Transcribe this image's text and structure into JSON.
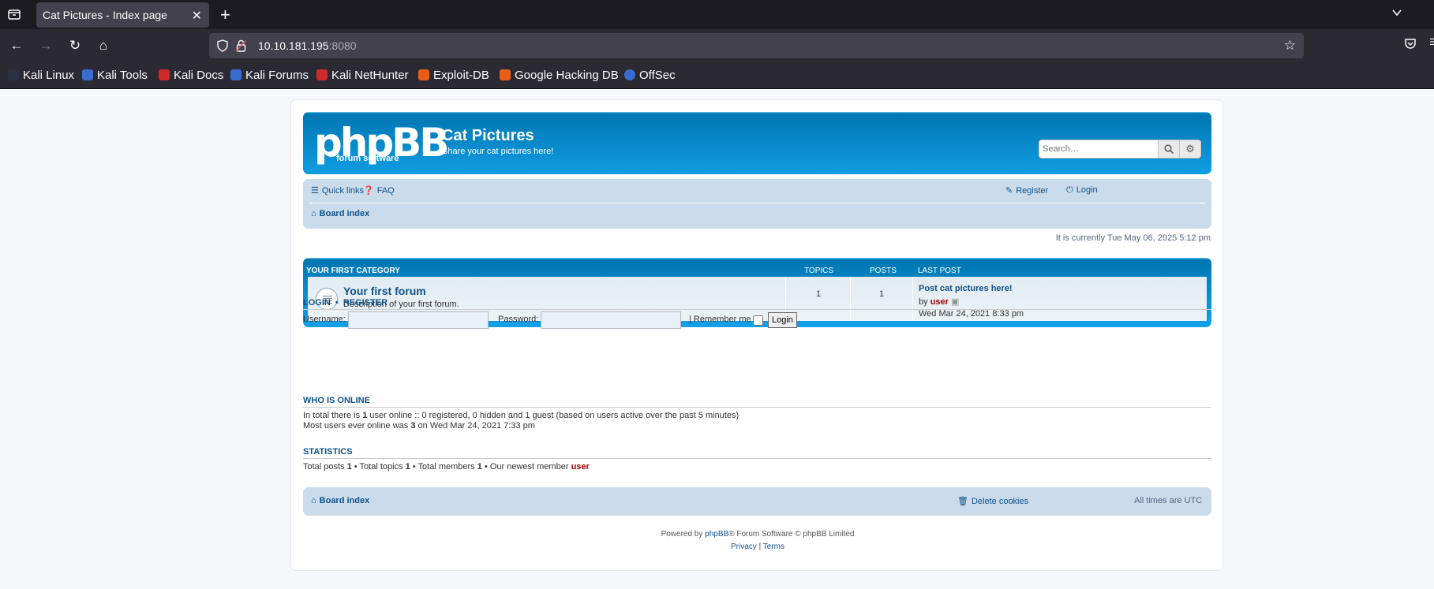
{
  "browser": {
    "tab_title": "Cat Pictures - Index page",
    "url_host": "10.10.181.195",
    "url_port": ":8080",
    "bookmarks": [
      "Kali Linux",
      "Kali Tools",
      "Kali Docs",
      "Kali Forums",
      "Kali NetHunter",
      "Exploit-DB",
      "Google Hacking DB",
      "OffSec"
    ]
  },
  "header": {
    "logo_text": "phpBB",
    "logo_sub": "forum  software",
    "site_title": "Cat Pictures",
    "site_desc": "Share your cat pictures here!",
    "search_placeholder": "Search…"
  },
  "nav": {
    "quick_links": "Quick links",
    "faq": "FAQ",
    "register": "Register",
    "login": "Login",
    "board_index": "Board index"
  },
  "datetime": "It is currently Tue May 06, 2025 5:12 pm",
  "category": {
    "name": "YOUR FIRST CATEGORY",
    "col_topics": "TOPICS",
    "col_posts": "POSTS",
    "col_last_post": "LAST POST",
    "forum_title": "Your first forum",
    "forum_desc": "Description of your first forum.",
    "topics": "1",
    "posts": "1",
    "last_post_title": "Post cat pictures here!",
    "last_post_by": "by",
    "last_post_user": "user",
    "last_post_date": "Wed Mar 24, 2021 8:33 pm"
  },
  "login_box": {
    "heading_login": "LOGIN",
    "heading_sep": "•",
    "heading_register": "REGISTER",
    "username_label": "Username:",
    "password_label": "Password:",
    "remember_label": "| Remember me",
    "login_button": "Login"
  },
  "online": {
    "heading": "WHO IS ONLINE",
    "line1_a": "In total there is",
    "line1_count": "1",
    "line1_b": "user online :: 0 registered, 0 hidden and 1 guest (based on users active over the past 5 minutes)",
    "line2_a": "Most users ever online was",
    "line2_count": "3",
    "line2_b": "on Wed Mar 24, 2021 7:33 pm"
  },
  "stats": {
    "heading": "STATISTICS",
    "posts_label": "Total posts",
    "posts": "1",
    "topics_label": "• Total topics",
    "topics": "1",
    "members_label": "• Total members",
    "members": "1",
    "newest_label": "• Our newest member",
    "newest": "user"
  },
  "footer": {
    "board_index": "Board index",
    "delete_cookies": "Delete cookies",
    "timezone": "All times are UTC",
    "powered_a": "Powered by",
    "powered_link": "phpBB",
    "powered_b": "® Forum Software © phpBB Limited",
    "privacy": "Privacy",
    "sep": "|",
    "terms": "Terms"
  }
}
